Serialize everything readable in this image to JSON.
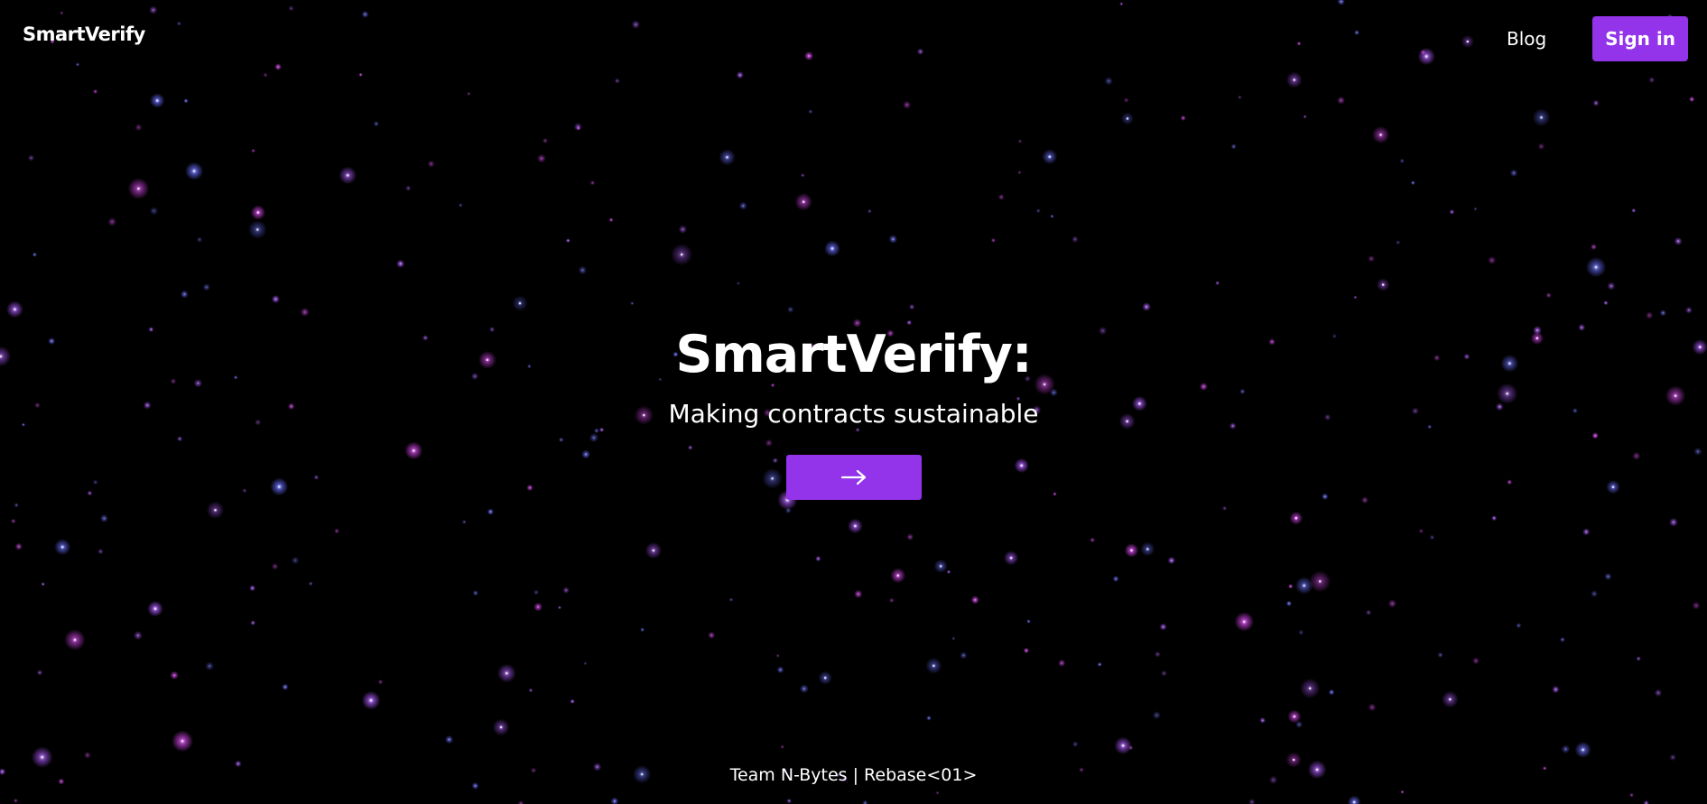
{
  "colors": {
    "background": "#000000",
    "accent": "#9333ea",
    "text": "#ffffff",
    "star_pink": "#d946ef",
    "star_violet": "#a855f7",
    "star_blue": "#6366f1"
  },
  "navbar": {
    "brand": "SmartVerify",
    "blog_label": "Blog",
    "signin_label": "Sign in"
  },
  "hero": {
    "title": "SmartVerify:",
    "subtitle": "Making contracts sustainable",
    "cta_icon": "arrow-right-icon"
  },
  "footer": {
    "text": "Team N-Bytes | Rebase<01>"
  }
}
